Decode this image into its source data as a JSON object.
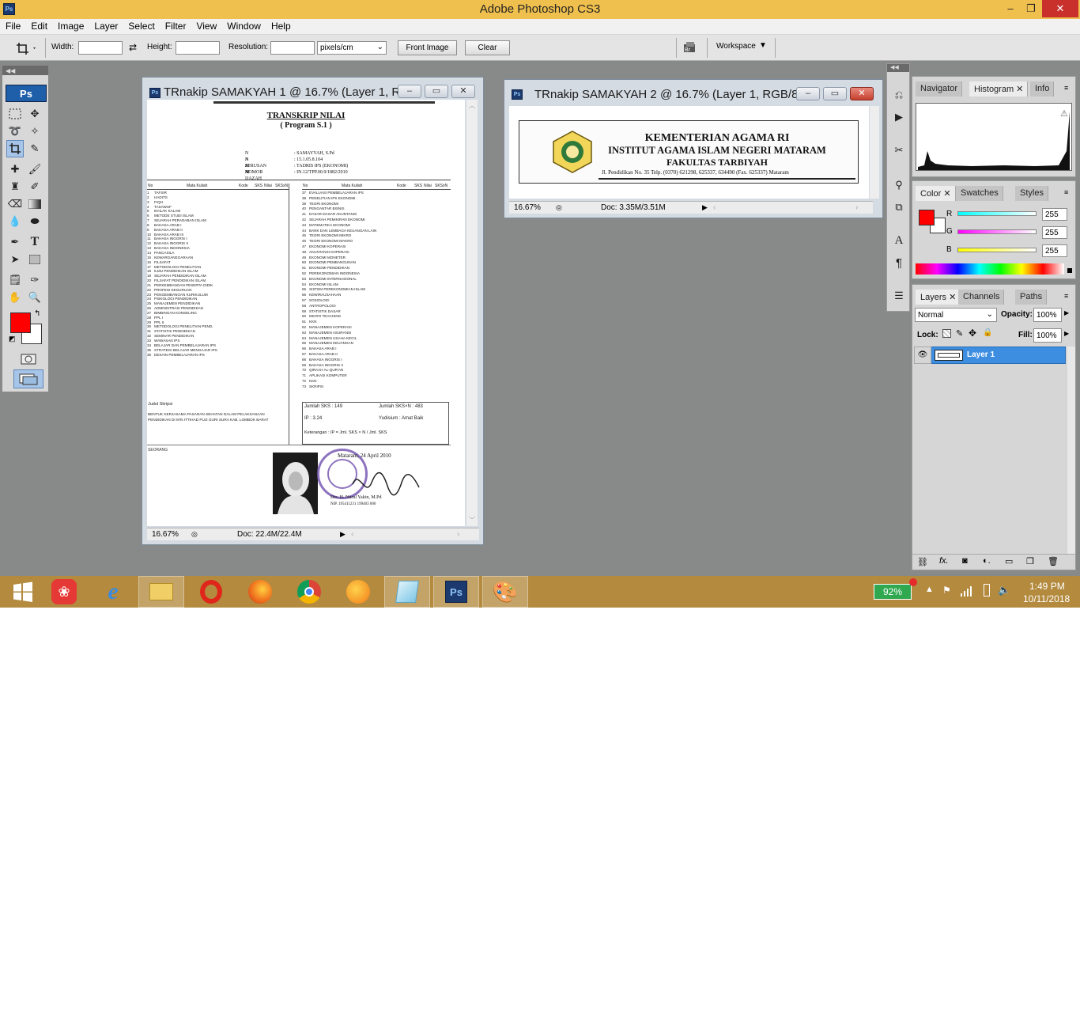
{
  "app": {
    "title": "Adobe Photoshop CS3",
    "icon_label": "Ps"
  },
  "window_controls": {
    "minimize": "–",
    "restore": "❐",
    "close": "✕"
  },
  "menu": [
    "File",
    "Edit",
    "Image",
    "Layer",
    "Select",
    "Filter",
    "View",
    "Window",
    "Help"
  ],
  "options": {
    "width_label": "Width:",
    "width_value": "",
    "height_label": "Height:",
    "height_value": "",
    "resolution_label": "Resolution:",
    "resolution_value": "",
    "units": "pixels/cm",
    "front_image": "Front Image",
    "clear": "Clear",
    "workspace": "Workspace"
  },
  "toolbox": {
    "logo": "Ps",
    "foreground_color": "#ff0000",
    "background_color": "#ffffff"
  },
  "doc1": {
    "title": "TRnakip SAMAKYAH 1 @ 16.7% (Layer 1, R...",
    "zoom": "16.67%",
    "doc_size": "Doc: 22.4M/22.4M",
    "heading": "TRANSKRIP NILAI",
    "subheading": "( Program S.1 )",
    "fields": [
      {
        "label": "N A M A",
        "value": ": SAMAYYAH, S.Pd"
      },
      {
        "label": "N I M",
        "value": ": 15.1.05.8.104"
      },
      {
        "label": "JURUSAN",
        "value": ": TADRIS IPS (EKONOMI)"
      },
      {
        "label": "NOMOR IJAZAH",
        "value": ": IN.12/TPP.00.9/1882/2010"
      }
    ],
    "col_headers": [
      "No",
      "Mata Kuliah",
      "Kode",
      "SKS",
      "Nilai",
      "SKSxN"
    ],
    "courses_left": [
      "TAFSIR",
      "HADITS",
      "FIQH",
      "TASAWUF",
      "IKHLAK KALAM",
      "METODE STUDI ISLAM",
      "SEJARAH PERADABAN ISLAM",
      "BAHASA ARAB I",
      "BAHASA ARAB II",
      "BAHASA ARAB III",
      "BAHASA INGGRIS I",
      "BAHASA INGGRIS II",
      "BAHASA INDONESIA",
      "PANCASILA",
      "KEWARGANEGARAAN",
      "FILSAFAT",
      "METODOLOGI PENELITIAN",
      "ILMU PENDIDIKAN ISLAM",
      "SEJARAH PENDIDIKAN ISLAM",
      "FILSAFAT PENDIDIKAN ISLAM",
      "PERKEMBANGAN PESERTA DIDIK",
      "PROFESI KEGURUAN",
      "PENGEMBANGAN KURIKULUM",
      "PSIKOLOGI PENDIDIKAN",
      "MANAJEMEN PENDIDIKAN",
      "ADMINISTRASI PENDIDIKAN",
      "BIMBINGAN KONSELING",
      "PPL I",
      "PPL II",
      "METODOLOGI PENELITIAN PEND.",
      "STATISTIK PENDIDIKAN",
      "SEMINAR PENDIDIKAN",
      "WAWASAN IPS",
      "BELAJAR DAN PEMBELAJARAN IPS",
      "STRATEGI BELAJAR MENGAJAR IPS",
      "DESAIN PEMBELAJARAN IPS"
    ],
    "courses_right": [
      "EVALUASI PEMBELAJARAN IPS",
      "PENELITIAN IPS EKONOMI",
      "TEORI EKONOMI",
      "PENGANTAR BISNIS",
      "DASAR-DASAR AKUNTANSI",
      "SEJARAH PEMIKIRAN EKONOMI",
      "MATEMATIKA EKONOMI",
      "BANK DAN LEMBAGA KEUANGAN LAIN",
      "TEORI EKONOMI MIKRO",
      "TEORI EKONOMI MAKRO",
      "EKONOMI KOPERASI",
      "AKUNTANSI KOPERASI",
      "EKONOMI MONETER",
      "EKONOMI PEMBANGUNAN",
      "EKONOMI PENDIDIKAN",
      "PEREKONOMIAN INDONESIA",
      "EKONOMI INTERNASIONAL",
      "EKONOMI ISLAM",
      "SISTEM PEREKONOMIAN ISLAM",
      "KEWIRAUSAHAAN",
      "SOSIOLOGI",
      "ANTROPOLOGI",
      "STATISTIK DASAR",
      "MICRO TEACHING",
      "KKN",
      "MANAJEMEN KOPERASI",
      "MANAJEMEN ASURANSI",
      "MANAJEMEN USAHA KECIL",
      "MANAJEMEN KEUANGAN",
      "BAHASA ARAB I",
      "BAHASA ARAB II",
      "BAHASA INGGRIS I",
      "BAHASA INGGRIS II",
      "QIRAAH AL-QUR'AN",
      "APLIKASI KOMPUTER",
      "KKN",
      "SKRIPSI"
    ],
    "jumlah_sks": "Jumlah SKS : 149",
    "jumlah_sksn": "Jumlah SKS×N : 483",
    "ip": "IP : 3.24",
    "yudisium": "Yudisium : Amat Baik",
    "keterangan": "Keterangan : IP = Jml. SKS × N / Jml. SKS",
    "judul_skripsi_label": "Judul Skripsi",
    "judul_skripsi": "BENTUK KERJASAMA PASARAN SEHATAN DALAM PELAKSANAAN PENDIDIKAN DI MTs ITTIHAD PUJI GURI SURA KAB. LOMBOK BARAT",
    "seorang_label": "SEORANG",
    "place_date": "Mataram, 24 April 2010",
    "signer": "Drs. H. Nurul Yakin, M.Pd",
    "signer_nip": "NIP. 195411231 199403 006"
  },
  "doc2": {
    "title": "TRnakip SAMAKYAH 2 @ 16.7% (Layer 1, RGB/8)",
    "zoom": "16.67%",
    "doc_size": "Doc: 3.35M/3.51M",
    "line1": "KEMENTERIAN AGAMA RI",
    "line2": "INSTITUT AGAMA ISLAM NEGERI MATARAM",
    "line3": "FAKULTAS TARBIYAH",
    "address": "Jl. Pendidikan No. 35 Telp. (0370) 621298, 625337, 634490 (Fax. 625337) Mataram"
  },
  "panels": {
    "top_tabs": [
      "Navigator",
      "Histogram",
      "Info"
    ],
    "color_tabs": [
      "Color",
      "Swatches",
      "Styles"
    ],
    "color": {
      "r_label": "R",
      "r": "255",
      "g_label": "G",
      "g": "255",
      "b_label": "B",
      "b": "255",
      "swatch": "#ff0000"
    },
    "layer_tabs": [
      "Layers",
      "Channels",
      "Paths"
    ],
    "blend_mode": "Normal",
    "opacity_label": "Opacity:",
    "opacity": "100%",
    "lock_label": "Lock:",
    "fill_label": "Fill:",
    "fill": "100%",
    "layer_name": "Layer 1"
  },
  "taskbar": {
    "battery": "92%",
    "time": "1:49 PM",
    "date": "10/11/2018"
  }
}
